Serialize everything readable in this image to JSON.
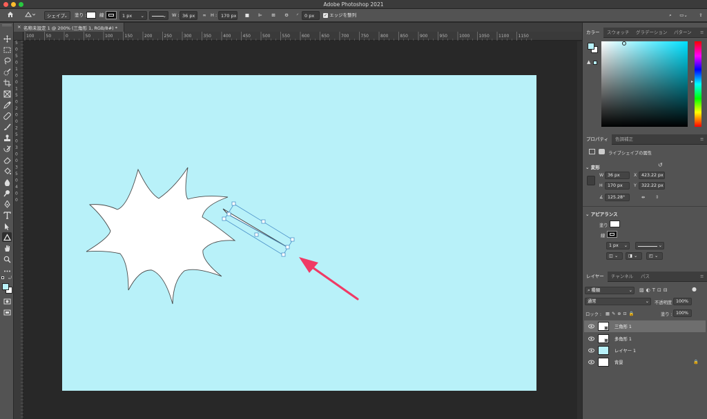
{
  "window": {
    "title": "Adobe Photoshop 2021"
  },
  "options_bar": {
    "tool_mode": "シェイプ",
    "fill_label": "塗り :",
    "stroke_label": "線 :",
    "stroke_width": "1 px",
    "w_label": "W :",
    "w_value": "36 px",
    "h_label": "H :",
    "h_value": "170 px",
    "corner_value": "0 px",
    "align_edges_label": "エッジを整列"
  },
  "document": {
    "tab_title": "名称未設定 1 @ 200% (三角形 1, RGB/8#) *"
  },
  "ruler_h": [
    "100",
    "50",
    "0",
    "50",
    "100",
    "150",
    "200",
    "250",
    "300",
    "350",
    "400",
    "450",
    "500",
    "550",
    "600",
    "650",
    "700",
    "750",
    "800",
    "850",
    "900",
    "950",
    "1000",
    "1050",
    "1100",
    "1150"
  ],
  "ruler_v": [
    "5",
    "0",
    "5",
    "0",
    "1",
    "0",
    "0",
    "1",
    "5",
    "0",
    "2",
    "0",
    "0",
    "2",
    "5",
    "0",
    "3",
    "0",
    "0",
    "3",
    "5",
    "0",
    "4",
    "0",
    "0"
  ],
  "color_panel": {
    "tabs": [
      "カラー",
      "スウォッチ",
      "グラデーション",
      "パターン"
    ],
    "active_tab": "カラー"
  },
  "properties_panel": {
    "tabs": [
      "プロパティ",
      "色調補正"
    ],
    "active_tab": "プロパティ",
    "subtitle": "ライブシェイプの属性",
    "transform_title": "変形",
    "w_label": "W",
    "w_value": "36 px",
    "x_label": "X",
    "x_value": "423.22 px",
    "h_label": "H",
    "h_value": "170 px",
    "y_label": "Y",
    "y_value": "322.22 px",
    "angle_value": "125.28°",
    "appearance_title": "アピアランス",
    "fill_label": "塗り",
    "stroke_label": "線",
    "stroke_width": "1 px"
  },
  "layers_panel": {
    "tabs": [
      "レイヤー",
      "チャンネル",
      "パス"
    ],
    "active_tab": "レイヤー",
    "filter_label": "種類",
    "blend_mode": "通常",
    "opacity_label": "不透明度 :",
    "opacity_value": "100%",
    "lock_label": "ロック :",
    "fill_label": "塗り :",
    "fill_value": "100%",
    "layers": [
      {
        "name": "三角形 1",
        "selected": true,
        "thumb": "shape"
      },
      {
        "name": "多角形 1",
        "selected": false,
        "thumb": "shape"
      },
      {
        "name": "レイヤー 1",
        "selected": false,
        "thumb": "#b8f1f9"
      },
      {
        "name": "背景",
        "selected": false,
        "thumb": "#ffffff",
        "locked": true
      }
    ]
  },
  "colors": {
    "canvas_background": "#b8f1f9",
    "shape_fill": "#ffffff",
    "annotation_arrow": "#f03a65",
    "selection_outline": "#4a90c8"
  }
}
